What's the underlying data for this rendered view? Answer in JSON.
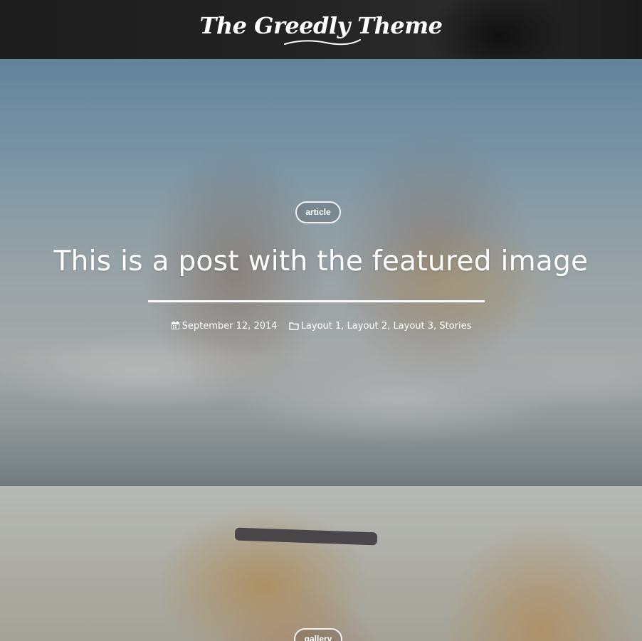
{
  "header": {
    "logo_text": "The Greedly Theme"
  },
  "posts": [
    {
      "category_badge": "article",
      "title": "This is a post with the featured image",
      "date": "September 12, 2014",
      "categories": [
        "Layout 1",
        "Layout 2",
        "Layout 3",
        "Stories"
      ]
    },
    {
      "category_badge": "gallery"
    }
  ],
  "icons": {
    "date": "calendar-icon",
    "categories": "folder-icon"
  },
  "colors": {
    "header_bg": "#1e1e1e",
    "text": "#ffffff",
    "badge_border": "#f2f2f2"
  }
}
